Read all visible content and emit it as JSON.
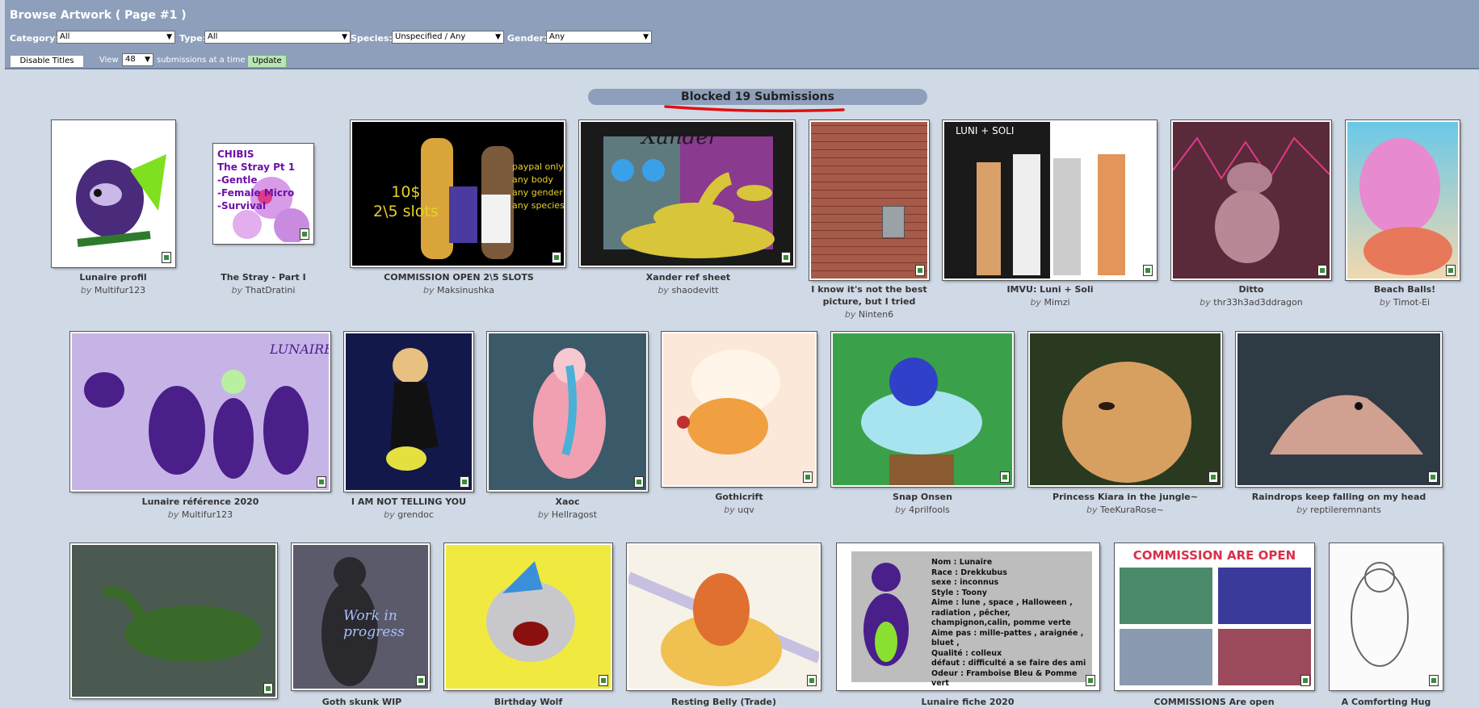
{
  "header": {
    "title": "Browse Artwork ( Page #1 )",
    "filters": {
      "category_label": "Category:",
      "category_value": "All",
      "type_label": "Type:",
      "type_value": "All",
      "species_label": "Species:",
      "species_value": "Unspecified / Any",
      "gender_label": "Gender:",
      "gender_value": "Any"
    },
    "disable_titles_label": "Disable Titles",
    "view_label": "View",
    "per_page_value": "48",
    "per_page_suffix": "submissions at a time",
    "update_label": "Update"
  },
  "blocked_banner": "Blocked 19 Submissions",
  "by_word": "by",
  "submissions": [
    {
      "title": "Lunaire profil",
      "author": "Multifur123"
    },
    {
      "title": "The Stray - Part I",
      "author": "ThatDratini",
      "thumb_text": "CHIBIS\nThe Stray Pt 1\n-Gentle\n-Female Micro\n-Survival"
    },
    {
      "title": "COMMISSION OPEN 2\\5 SLOTS",
      "author": "Maksinushka",
      "thumb_text_a": "10$\n2\\5 slots",
      "thumb_text_b": "paypal only\nany body\nany gender\nany species"
    },
    {
      "title": "Xander ref sheet",
      "author": "shaodevitt",
      "thumb_text": "Xander"
    },
    {
      "title": "I know it's not the best picture, but I tried",
      "author": "Ninten6"
    },
    {
      "title": "IMVU: Luni + Soli",
      "author": "Mimzi",
      "thumb_text": "LUNI + SOLI"
    },
    {
      "title": "Ditto",
      "author": "thr33h3ad3ddragon"
    },
    {
      "title": "Beach Balls!",
      "author": "Timot-Ei"
    },
    {
      "title": "Lunaire référence 2020",
      "author": "Multifur123",
      "thumb_text": "LUNAIRE"
    },
    {
      "title": "I AM NOT TELLING YOU",
      "author": "grendoc"
    },
    {
      "title": "Xaoc",
      "author": "Hellragost"
    },
    {
      "title": "Gothicrift",
      "author": "uqv"
    },
    {
      "title": "Snap Onsen",
      "author": "4prilfools"
    },
    {
      "title": "Princess Kiara in the jungle~",
      "author": "TeeKuraRose~"
    },
    {
      "title": "Raindrops keep falling on my head",
      "author": "reptileremnants"
    },
    {
      "title": "Goth skunk WIP",
      "author": "",
      "thumb_text": "Work in progress"
    },
    {
      "title": "Birthday Wolf",
      "author": ""
    },
    {
      "title": "Resting Belly (Trade)",
      "author": ""
    },
    {
      "title": "Lunaire fiche 2020",
      "author": "",
      "thumb_text": "Nom : Lunaire\nRace : Drekkubus\nsexe : inconnus\nStyle : Toony\nAime : lune , space , Halloween , radiation , pêcher, champignon,calin, pomme verte\nAime pas : mille-pattes , araignée , bluet ,\nQualité : colleux\ndéfaut : difficulté a se faire des ami\nOdeur : Framboise Bleu & Pomme vert"
    },
    {
      "title": "COMMISSIONS Are open",
      "author": "",
      "thumb_text": "COMMISSION ARE OPEN"
    },
    {
      "title": "A Comforting Hug",
      "author": ""
    }
  ],
  "colors": {
    "header_bg": "#8e9fbb",
    "page_bg": "#d0d9e6",
    "update_button": "#b9e6b4",
    "underline_annotation": "#e01010"
  }
}
